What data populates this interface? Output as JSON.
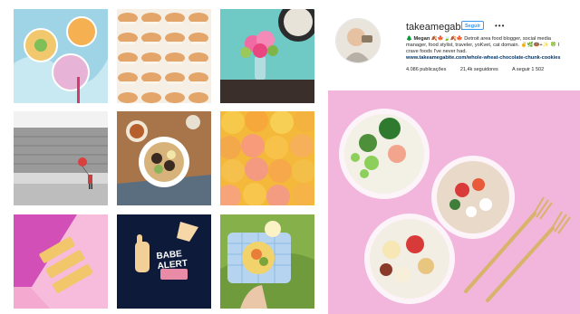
{
  "profile": {
    "username": "takeamegabite",
    "follow_label": "Seguir",
    "more_label": "•••",
    "bio_name": "🌲 Megan 🍂🍁🍃🍂🍁",
    "bio_text": "Detroit area food blogger, social media manager, food stylist, traveler, yoKvet, cat domain. ✌️🌿🍩+✨ 🍀 I crave foods I've never had.",
    "link": "www.takeamegabite.com/whole-wheat-chocolate-chunk-cookies",
    "stats": {
      "posts": "4.086 publicações",
      "followers": "21,4k seguidores",
      "following": "A seguir 1 502"
    }
  },
  "grid": {
    "tiles": [
      {
        "label": "drinks-with-fruit"
      },
      {
        "label": "rows-of-cream-puffs"
      },
      {
        "label": "pink-flowers-in-vase"
      },
      {
        "label": "street-with-balloon",
        "badge": "video-icon"
      },
      {
        "label": "granola-bowl-on-wood",
        "badge": "multi-icon"
      },
      {
        "label": "peaches-pile"
      },
      {
        "label": "babe-text-pink"
      },
      {
        "label": "enamel-pins-babe-alert",
        "pin_text": "BABE ALERT"
      },
      {
        "label": "fruit-bowl-in-hand"
      }
    ]
  },
  "featured": {
    "label": "salad-jars-with-gold-forks"
  },
  "colors": {
    "accent": "#3897f0",
    "link": "#003569",
    "pink_bg": "#f2b6dd"
  }
}
